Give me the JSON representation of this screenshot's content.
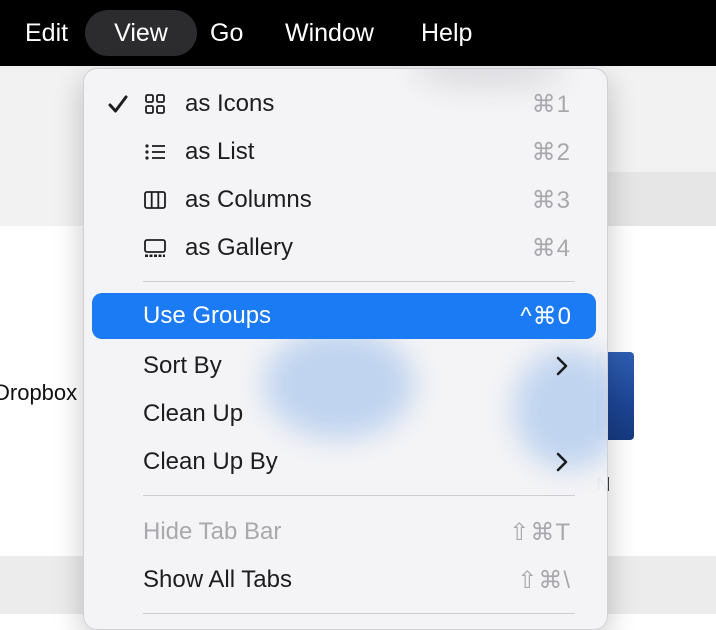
{
  "menubar": {
    "items": [
      {
        "label": "Edit",
        "active": false
      },
      {
        "label": "View",
        "active": true
      },
      {
        "label": "Go",
        "active": false
      },
      {
        "label": "Window",
        "active": false
      },
      {
        "label": "Help",
        "active": false
      }
    ]
  },
  "background": {
    "dropbox_label": "Dropbox",
    "partial_label": "N"
  },
  "menu": {
    "view_modes": [
      {
        "label": "as Icons",
        "shortcut": "⌘1",
        "checked": true,
        "icon": "grid-icon"
      },
      {
        "label": "as List",
        "shortcut": "⌘2",
        "checked": false,
        "icon": "list-icon"
      },
      {
        "label": "as Columns",
        "shortcut": "⌘3",
        "checked": false,
        "icon": "columns-icon"
      },
      {
        "label": "as Gallery",
        "shortcut": "⌘4",
        "checked": false,
        "icon": "gallery-icon"
      }
    ],
    "use_groups": {
      "label": "Use Groups",
      "shortcut": "^⌘0"
    },
    "sort_by": {
      "label": "Sort By"
    },
    "clean_up": {
      "label": "Clean Up"
    },
    "clean_up_by": {
      "label": "Clean Up By"
    },
    "hide_tab_bar": {
      "label": "Hide Tab Bar",
      "shortcut": "⇧⌘T",
      "disabled": true
    },
    "show_all_tabs": {
      "label": "Show All Tabs",
      "shortcut": "⇧⌘\\"
    }
  },
  "colors": {
    "accent": "#1a7bf5",
    "menubar_bg": "#000000",
    "disabled_text": "#a8a8ad"
  }
}
